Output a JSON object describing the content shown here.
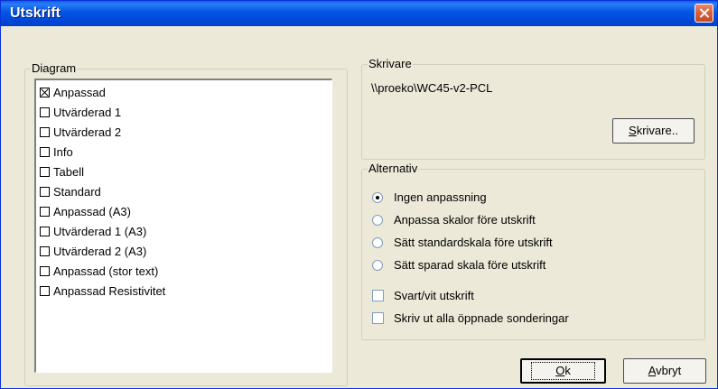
{
  "window": {
    "title": "Utskrift"
  },
  "diagram": {
    "legend": "Diagram",
    "items": [
      {
        "label": "Anpassad",
        "checked": true
      },
      {
        "label": "Utvärderad 1",
        "checked": false
      },
      {
        "label": "Utvärderad 2",
        "checked": false
      },
      {
        "label": "Info",
        "checked": false
      },
      {
        "label": "Tabell",
        "checked": false
      },
      {
        "label": "Standard",
        "checked": false
      },
      {
        "label": "Anpassad (A3)",
        "checked": false
      },
      {
        "label": "Utvärderad 1 (A3)",
        "checked": false
      },
      {
        "label": "Utvärderad 2 (A3)",
        "checked": false
      },
      {
        "label": "Anpassad (stor text)",
        "checked": false
      },
      {
        "label": "Anpassad Resistivitet",
        "checked": false
      }
    ]
  },
  "printer": {
    "legend": "Skrivare",
    "path": "\\\\proeko\\WC45-v2-PCL",
    "button_first": "S",
    "button_rest": "krivare.."
  },
  "options": {
    "legend": "Alternativ",
    "radios": [
      {
        "label": "Ingen anpassning",
        "selected": true
      },
      {
        "label": "Anpassa skalor före utskrift",
        "selected": false
      },
      {
        "label": "Sätt standardskala före utskrift",
        "selected": false
      },
      {
        "label": "Sätt sparad skala före utskrift",
        "selected": false
      }
    ],
    "checks": [
      {
        "label": "Svart/vit utskrift",
        "checked": false
      },
      {
        "label": "Skriv ut alla öppnade sonderingar",
        "checked": false
      }
    ]
  },
  "buttons": {
    "ok_first": "O",
    "ok_rest": "k",
    "cancel_first": "A",
    "cancel_rest": "vbryt"
  }
}
